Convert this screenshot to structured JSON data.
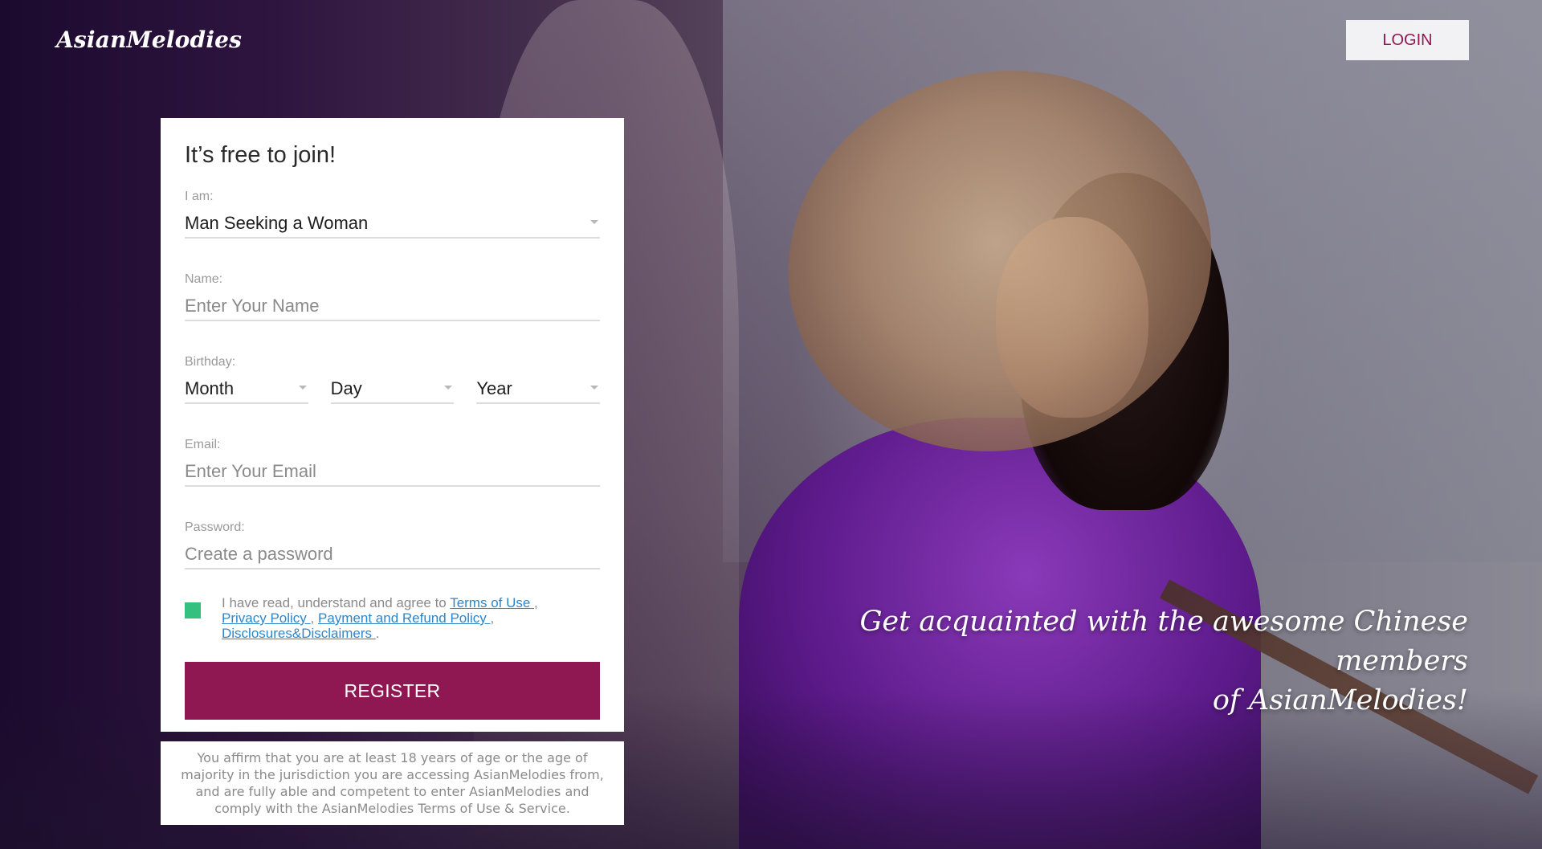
{
  "header": {
    "logo": "AsianMelodies",
    "login_label": "LOGIN"
  },
  "form": {
    "title": "It’s free to join!",
    "iam": {
      "label": "I am:",
      "value": "Man Seeking a Woman"
    },
    "name": {
      "label": "Name:",
      "placeholder": "Enter Your Name"
    },
    "birthday": {
      "label": "Birthday:",
      "month": "Month",
      "day": "Day",
      "year": "Year"
    },
    "email": {
      "label": "Email:",
      "placeholder": "Enter Your Email"
    },
    "password": {
      "label": "Password:",
      "placeholder": "Create a password"
    },
    "agreement": {
      "prefix": "I have read, understand and agree to ",
      "terms": "Terms of Use ",
      "privacy": "Privacy Policy ",
      "payment": "Payment and Refund Policy ",
      "disclosures": "Disclosures&Disclaimers ",
      "sep1": ",",
      "sep2": ",",
      "sep3": ",",
      "end": "."
    },
    "register_label": "REGISTER"
  },
  "disclaimer": "You affirm that you are at least 18 years of age or the age of majority in the jurisdiction you are accessing AsianMelodies from, and are fully able and competent to enter AsianMelodies and comply with the AsianMelodies Terms of Use & Service.",
  "tagline": {
    "line1": "Get acquainted with the awesome Chinese members",
    "line2": "of AsianMelodies!"
  },
  "colors": {
    "accent": "#8f1752",
    "checkbox": "#36c080",
    "link": "#2e86c9"
  },
  "icons": {
    "dropdown": "chevron-down-icon"
  }
}
